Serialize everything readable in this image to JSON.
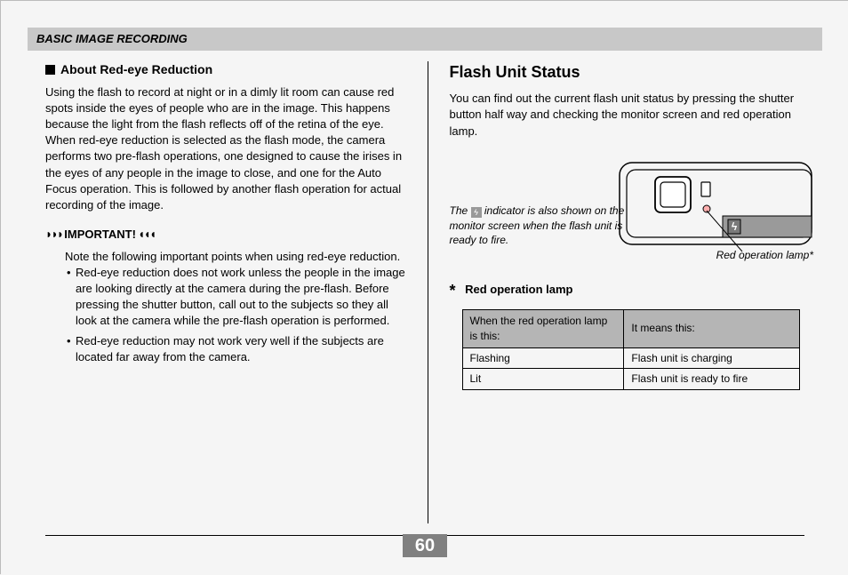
{
  "header": "BASIC IMAGE RECORDING",
  "left": {
    "heading": "About Red-eye Reduction",
    "body": "Using the flash to record at night or in a dimly lit room can cause red spots inside the eyes of people who are in the image. This happens because the light from the flash reflects off of the retina of the eye. When red-eye reduction is selected as the flash mode, the camera performs two pre-flash operations, one designed to cause the irises in the eyes of any people in the image to close, and one for the Auto Focus operation. This is followed by another flash operation for actual recording of the image.",
    "important_label": "IMPORTANT!",
    "important_intro": "Note the following important points when using red-eye reduction.",
    "bullets": [
      "Red-eye reduction does not work unless the people in the image are looking directly at the camera during the pre-flash. Before pressing the shutter button, call out to the subjects so they all look at the camera while the pre-flash operation is performed.",
      "Red-eye reduction may not work very well if the subjects are located far away from the camera."
    ]
  },
  "right": {
    "heading": "Flash Unit Status",
    "intro": "You can find out the current flash unit status by pressing the shutter button half way and checking the monitor screen and red operation lamp.",
    "diagram_note_pre": "The ",
    "diagram_note_post": " indicator is also shown on the monitor screen when the flash unit is ready to fire.",
    "lamp_callout": "Red operation lamp*",
    "star_heading": "Red operation lamp",
    "table": {
      "h1": "When the red operation lamp is this:",
      "h2": "It means this:",
      "rows": [
        {
          "c1": "Flashing",
          "c2": "Flash unit is charging"
        },
        {
          "c1": "Lit",
          "c2": "Flash unit is ready to fire"
        }
      ]
    }
  },
  "page_number": "60"
}
